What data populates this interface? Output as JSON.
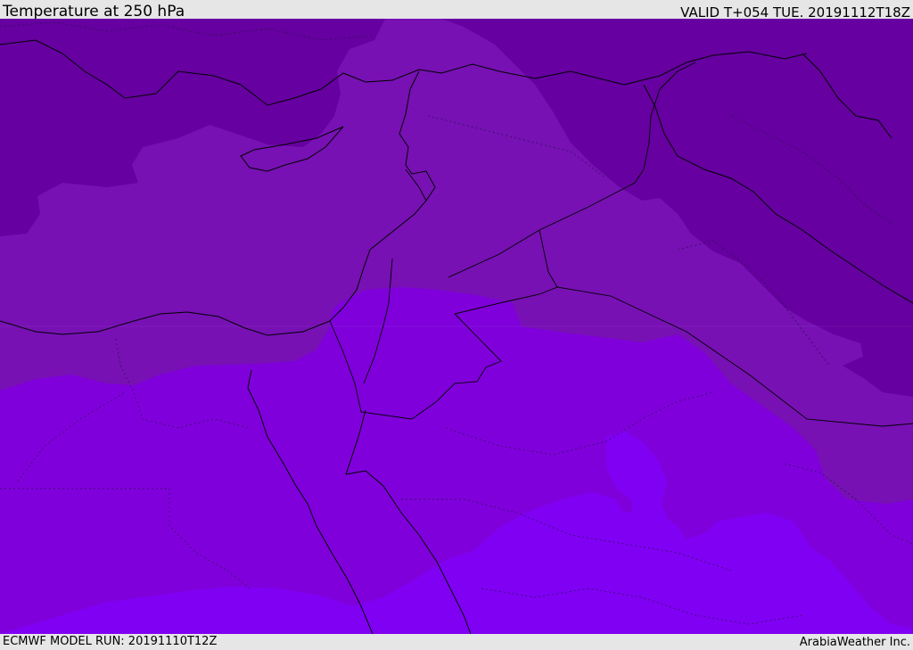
{
  "header": {
    "title": "Temperature at 250 hPa",
    "valid": "VALID T+054 TUE. 20191112T18Z"
  },
  "footer": {
    "model_run": "ECMWF MODEL RUN: 20191110T12Z",
    "credit": "ArabiaWeather Inc."
  },
  "map": {
    "variable": "temperature",
    "level": "250 hPa",
    "colors": {
      "coldest": "#6600a0",
      "cold": "#7711b3",
      "mid": "#8000dc",
      "warm": "#8000f4",
      "outline": "#000000"
    }
  }
}
